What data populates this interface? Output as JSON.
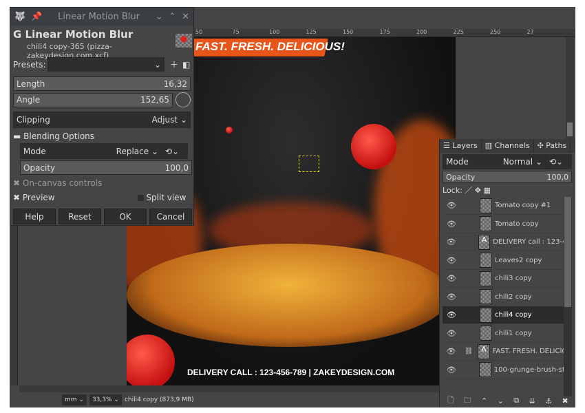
{
  "dialog": {
    "window_title": "Linear Motion Blur",
    "title": "Linear Motion Blur",
    "subtitle": "chili4 copy-365 (pizza-zakeydesign.com.xcf)",
    "presets_label": "Presets:",
    "length_label": "Length",
    "length_value": "16,32",
    "angle_label": "Angle",
    "angle_value": "152,65",
    "clipping_label": "Clipping",
    "clipping_value": "Adjust",
    "blending_label": "Blending Options",
    "mode_label": "Mode",
    "mode_value": "Replace",
    "opacity_label": "Opacity",
    "opacity_value": "100,0",
    "on_canvas_label": "On-canvas controls",
    "preview_label": "Preview",
    "split_view_label": "Split view",
    "buttons": {
      "help": "Help",
      "reset": "Reset",
      "ok": "OK",
      "cancel": "Cancel"
    }
  },
  "ruler": {
    "ticks": [
      "50",
      "75",
      "100",
      "125",
      "150",
      "175",
      "200",
      "225",
      "250",
      "27"
    ]
  },
  "canvas": {
    "banner": "FAST. FRESH. DELICIOUS!",
    "footer": "DELIVERY CALL : 123-456-789 | ZAKEYDESIGN.COM"
  },
  "status": {
    "unit": "mm",
    "zoom": "33,3%",
    "info": "chili4 copy (873,9 MB)"
  },
  "layers": {
    "tabs": [
      "Layers",
      "Channels",
      "Paths"
    ],
    "mode_label": "Mode",
    "mode_value": "Normal",
    "opacity_label": "Opacity",
    "opacity_value": "100,0",
    "lock_label": "Lock:",
    "items": [
      {
        "name": "Tomato copy #1"
      },
      {
        "name": "Tomato copy"
      },
      {
        "name": "DELIVERY call : 123-4",
        "text": true
      },
      {
        "name": "Leaves2 copy"
      },
      {
        "name": "chili3 copy"
      },
      {
        "name": "chili2 copy"
      },
      {
        "name": "chili4 copy",
        "selected": true
      },
      {
        "name": "chili1 copy"
      },
      {
        "name": "FAST. FRESH. DELICIO",
        "text": true,
        "chain": true
      },
      {
        "name": "100-grunge-brush-st"
      }
    ]
  },
  "colors": {
    "accent": "#e8551a",
    "bg": "#454545"
  }
}
